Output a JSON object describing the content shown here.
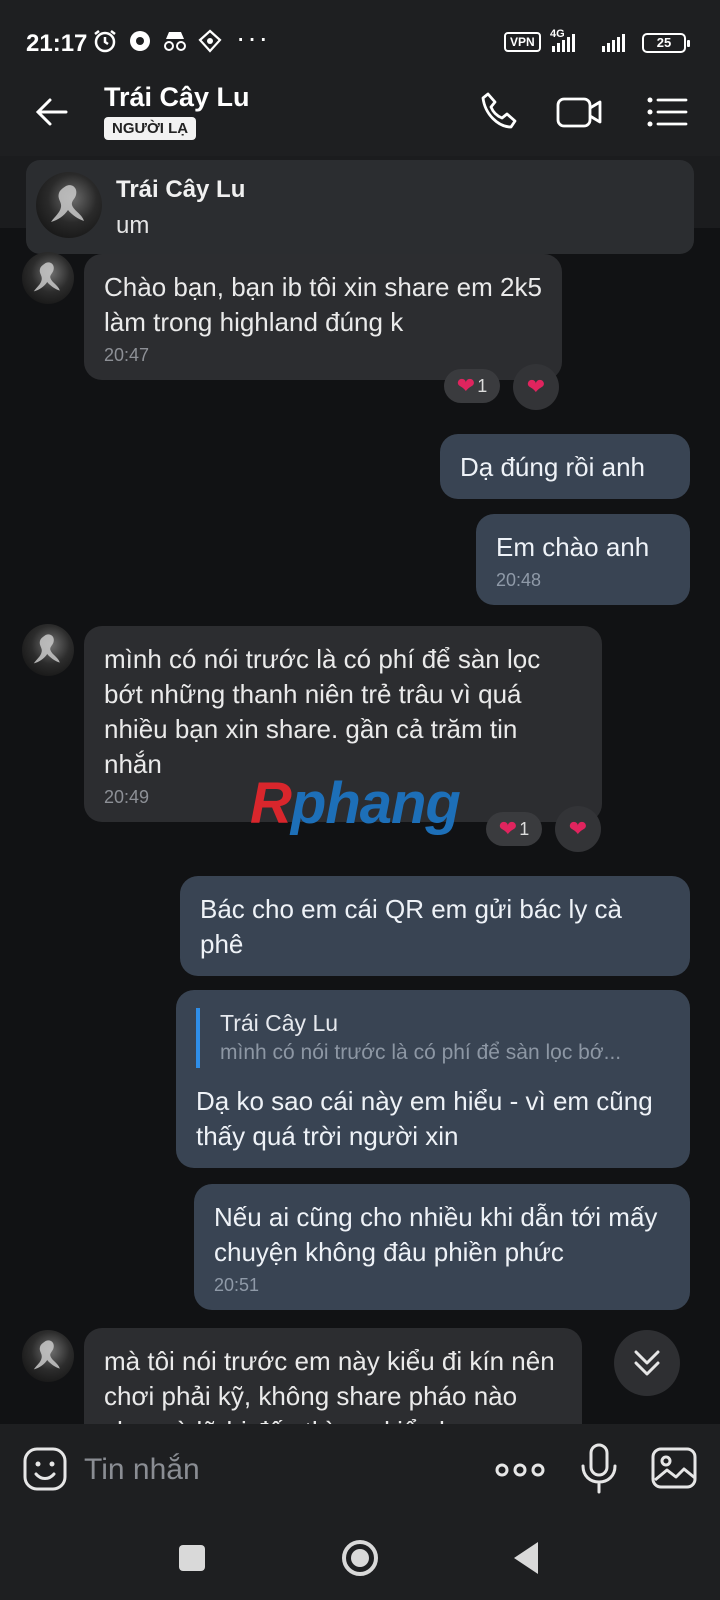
{
  "status_bar": {
    "time": "21:17",
    "overflow": "···",
    "vpn": "VPN",
    "network": "4G",
    "battery": "25"
  },
  "header": {
    "title": "Trái Cây Lu",
    "badge": "NGƯỜI LẠ"
  },
  "pinned": {
    "name": "Trái Cây Lu",
    "text": "um"
  },
  "messages": [
    {
      "text": "Chào bạn, bạn ib tôi xin share em 2k5 làm trong highland đúng k",
      "time": "20:47",
      "reaction_count": "1"
    },
    {
      "text": "Dạ đúng rồi anh"
    },
    {
      "text": "Em chào anh",
      "time": "20:48"
    },
    {
      "text": "mình có nói trước là có phí để sàn lọc bớt những thanh niên trẻ trâu vì quá nhiều bạn xin share. gần cả trăm tin nhắn",
      "time": "20:49",
      "reaction_count": "1"
    },
    {
      "text": "Bác cho em cái QR em gửi bác ly cà phê"
    },
    {
      "quote_name": "Trái Cây Lu",
      "quote_text": "mình có nói trước là có phí để sàn lọc bớ...",
      "text": "Dạ ko sao cái này em hiểu - vì em cũng thấy quá trời người xin"
    },
    {
      "text": "Nếu ai cũng cho nhiều khi dẫn tới mấy chuyện không đâu phiền phức",
      "time": "20:51"
    },
    {
      "text": "mà tôi nói trước em này kiểu đi kín nên chơi phải kỹ, không share pháo nào cho mà lỡ bị đến thì em kiểu họ"
    }
  ],
  "watermark": {
    "first": "R",
    "rest": "phang"
  },
  "composer": {
    "placeholder": "Tin nhắn"
  },
  "colors": {
    "incoming_bubble": "#2c2d30",
    "outgoing_bubble": "#394453",
    "heart": "#e0245e",
    "quote_bar": "#2f8ee8"
  }
}
